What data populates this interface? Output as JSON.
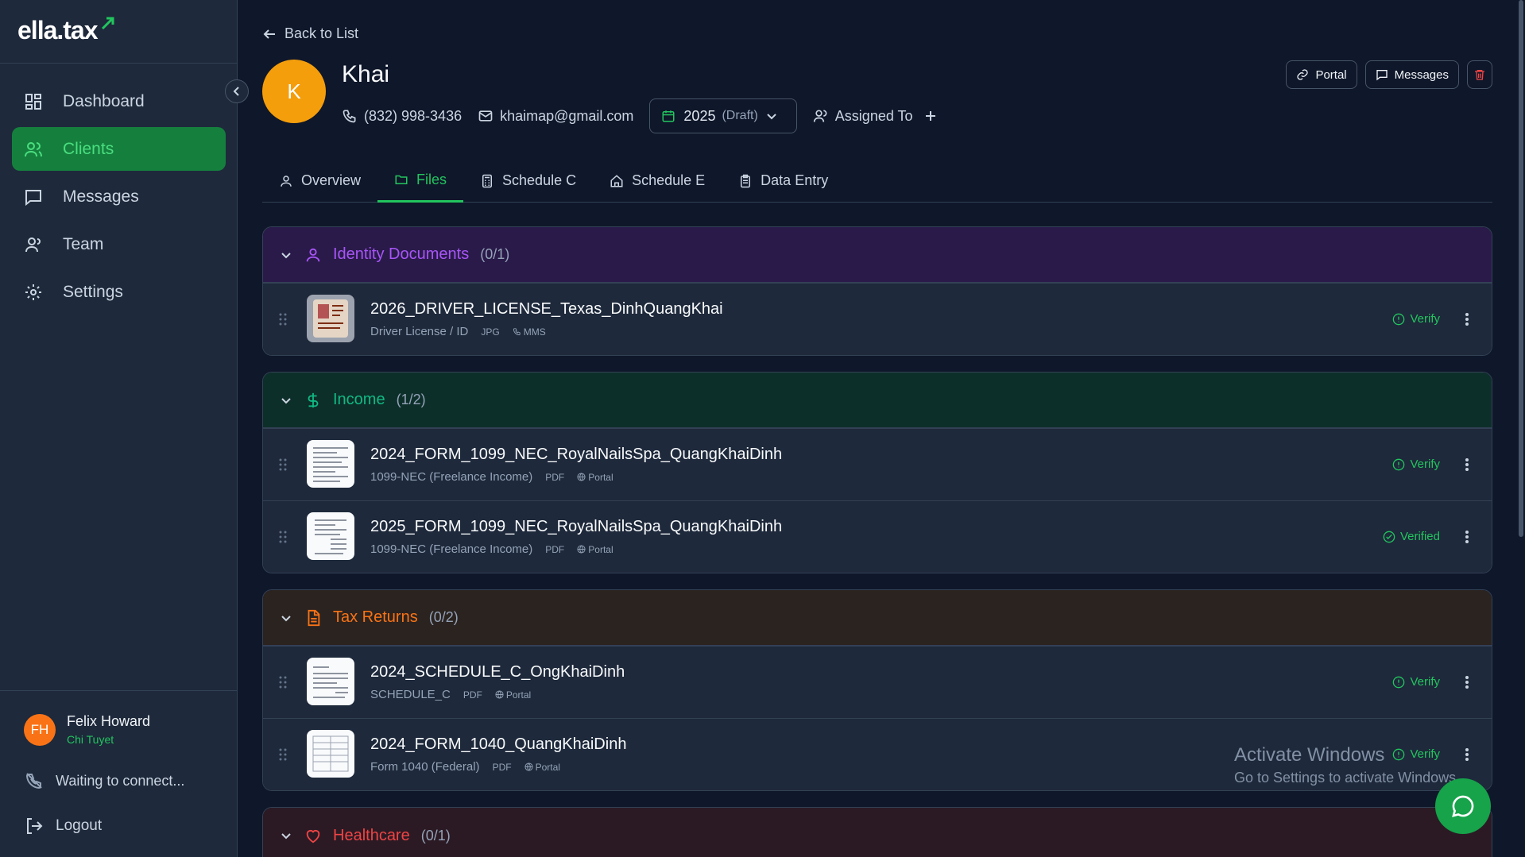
{
  "app": {
    "logo": "ella.tax"
  },
  "sidebar": {
    "items": [
      {
        "label": "Dashboard",
        "icon": "dashboard-icon"
      },
      {
        "label": "Clients",
        "icon": "users-icon",
        "active": true
      },
      {
        "label": "Messages",
        "icon": "message-icon"
      },
      {
        "label": "Team",
        "icon": "team-icon"
      },
      {
        "label": "Settings",
        "icon": "gear-icon"
      }
    ],
    "user": {
      "initials": "FH",
      "name": "Felix Howard",
      "subtitle": "Chi Tuyet"
    },
    "connection_status": "Waiting to connect...",
    "logout_label": "Logout"
  },
  "header": {
    "back_label": "Back to List",
    "client_initial": "K",
    "client_name": "Khai",
    "phone": "(832) 998-3436",
    "email": "khaimap@gmail.com",
    "year": "2025",
    "year_status": "(Draft)",
    "assigned_label": "Assigned To",
    "portal_label": "Portal",
    "messages_label": "Messages"
  },
  "tabs": [
    {
      "label": "Overview"
    },
    {
      "label": "Files",
      "active": true
    },
    {
      "label": "Schedule C"
    },
    {
      "label": "Schedule E"
    },
    {
      "label": "Data Entry"
    }
  ],
  "sections": [
    {
      "title": "Identity Documents",
      "count": "(0/1)",
      "color": "#a855f7",
      "bg": "#2a1a4a",
      "files": [
        {
          "name": "2026_DRIVER_LICENSE_Texas_DinhQuangKhai",
          "type": "Driver License / ID",
          "ext": "JPG",
          "source": "MMS",
          "status": "Verify"
        }
      ]
    },
    {
      "title": "Income",
      "count": "(1/2)",
      "color": "#10b981",
      "bg": "#0d2f2a",
      "files": [
        {
          "name": "2024_FORM_1099_NEC_RoyalNailsSpa_QuangKhaiDinh",
          "type": "1099-NEC (Freelance Income)",
          "ext": "PDF",
          "source": "Portal",
          "status": "Verify"
        },
        {
          "name": "2025_FORM_1099_NEC_RoyalNailsSpa_QuangKhaiDinh",
          "type": "1099-NEC (Freelance Income)",
          "ext": "PDF",
          "source": "Portal",
          "status": "Verified"
        }
      ]
    },
    {
      "title": "Tax Returns",
      "count": "(0/2)",
      "color": "#f97316",
      "bg": "#2b2320",
      "files": [
        {
          "name": "2024_SCHEDULE_C_OngKhaiDinh",
          "type": "SCHEDULE_C",
          "ext": "PDF",
          "source": "Portal",
          "status": "Verify"
        },
        {
          "name": "2024_FORM_1040_QuangKhaiDinh",
          "type": "Form 1040 (Federal)",
          "ext": "PDF",
          "source": "Portal",
          "status": "Verify"
        }
      ]
    },
    {
      "title": "Healthcare",
      "count": "(0/1)",
      "color": "#ef4444",
      "bg": "#2b1a24",
      "files": []
    }
  ],
  "watermark": {
    "line1": "Activate Windows",
    "line2": "Go to Settings to activate Windows."
  }
}
